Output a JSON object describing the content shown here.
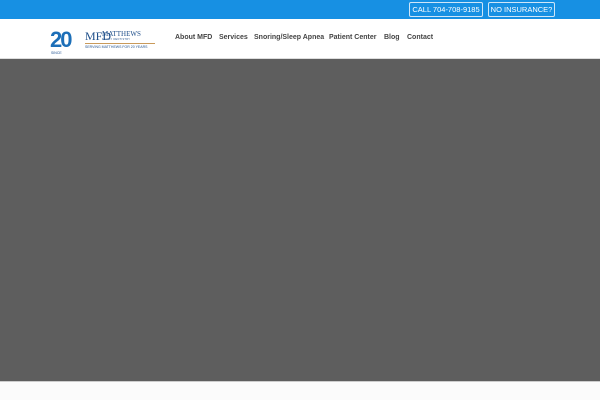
{
  "topbar": {
    "call_label": "CALL 704-708-9185",
    "insurance_label": "NO INSURANCE?"
  },
  "logo": {
    "anniversary": "20",
    "since": "SINCE",
    "monogram": "MFD",
    "name": "MATTHEWS",
    "subtitle": "FAMILY DENTISTRY",
    "tagline": "SERVING MATTHEWS FOR 20 YEARS"
  },
  "nav": {
    "items": [
      "About MFD",
      "Services",
      "Snoring/Sleep Apnea",
      "Patient Center",
      "Blog",
      "Contact"
    ]
  },
  "colors": {
    "topbar": "#1790e3",
    "hero": "#5e5e5e"
  }
}
